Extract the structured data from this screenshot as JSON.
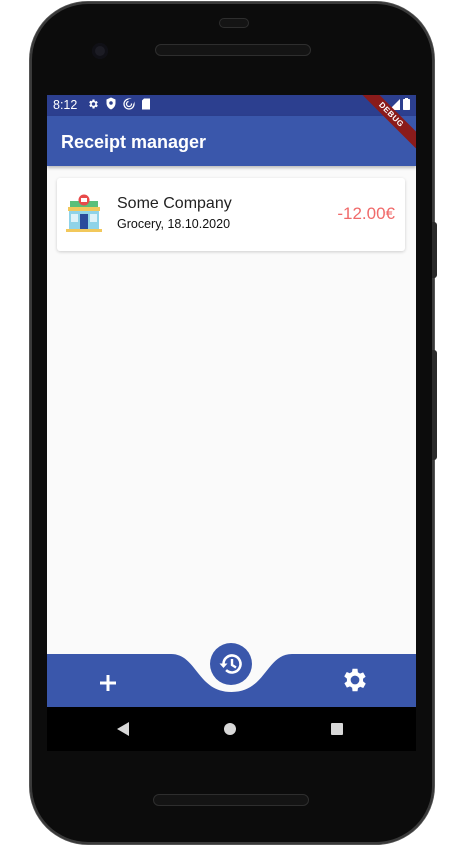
{
  "status_bar": {
    "time": "8:12",
    "left_icons": [
      "gear-icon",
      "shield-icon",
      "vpn-icon",
      "sd-card-icon"
    ],
    "right_icons": [
      "wifi-icon",
      "signal-icon",
      "battery-icon"
    ],
    "debug_label": "DEBUG"
  },
  "app_bar": {
    "title": "Receipt manager"
  },
  "receipts": [
    {
      "company": "Some Company",
      "meta": "Grocery, 18.10.2020",
      "amount": "-12.00€",
      "icon": "store-icon"
    }
  ],
  "bottom_bar": {
    "add_icon": "plus-icon",
    "center_icon": "history-icon",
    "settings_icon": "gear-icon"
  },
  "colors": {
    "status_bar": "#2c3f8f",
    "primary": "#3a57ab",
    "amount_negative": "#f06a6a",
    "background": "#fafafa"
  }
}
